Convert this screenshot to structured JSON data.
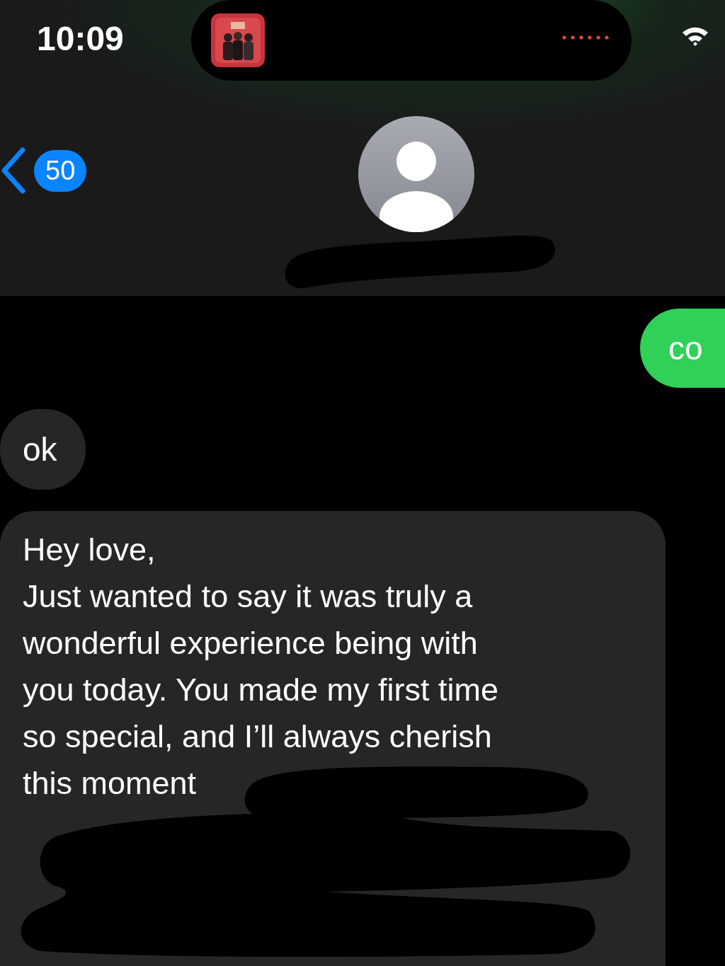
{
  "status_bar": {
    "time": "10:09"
  },
  "header": {
    "unread_count": "50"
  },
  "messages": [
    {
      "kind": "sent",
      "text": "co"
    },
    {
      "kind": "received",
      "text": "ok"
    },
    {
      "kind": "received_redacted",
      "text": "Hey love,\nJust wanted to say it was truly a\nwonderful experience being with\nyou today. You made my first time\nso special, and I’ll always cherish\nthis moment"
    }
  ]
}
